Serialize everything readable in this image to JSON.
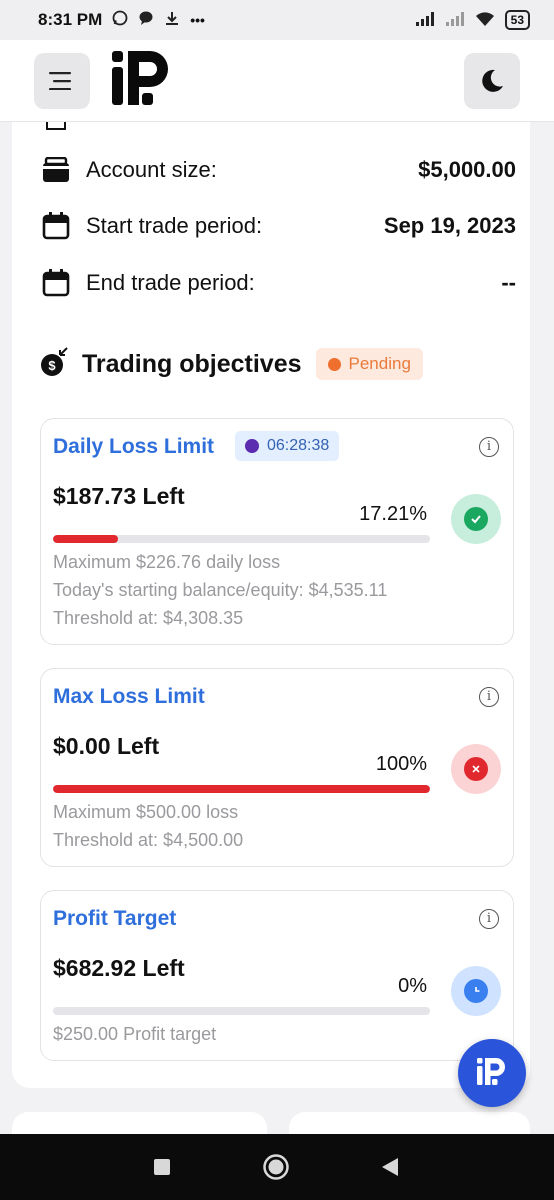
{
  "status_bar": {
    "time": "8:31 PM",
    "notif_icons": [
      "whatsapp-icon",
      "chat-icon",
      "download-icon"
    ],
    "more": "•••",
    "battery": "53"
  },
  "header": {
    "menu_icon": "hamburger-icon",
    "logo_icon": "brand-logo",
    "theme_icon": "moon-icon"
  },
  "account": {
    "rows": [
      {
        "label": "Account size:",
        "value": "$5,000.00",
        "icon": "wallet-icon"
      },
      {
        "label": "Start trade period:",
        "value": "Sep 19, 2023",
        "icon": "calendar-icon"
      },
      {
        "label": "End trade period:",
        "value": "--",
        "icon": "calendar-icon"
      }
    ]
  },
  "objectives": {
    "title": "Trading objectives",
    "status": "Pending",
    "cards": [
      {
        "title": "Daily Loss Limit",
        "timer": "06:28:38",
        "left": "$187.73 Left",
        "percent": "17.21%",
        "progress": 0.1721,
        "status": "passed",
        "status_bg": "#c7eedc",
        "status_color": "#1aa760",
        "details": [
          "Maximum $226.76 daily loss",
          "Today's starting balance/equity: $4,535.11",
          "Threshold at: $4,308.35"
        ]
      },
      {
        "title": "Max Loss Limit",
        "left": "$0.00 Left",
        "percent": "100%",
        "progress": 1.0,
        "status": "failed",
        "status_bg": "#fbd3d5",
        "status_color": "#e0282e",
        "details": [
          "Maximum $500.00 loss",
          "Threshold at: $4,500.00"
        ]
      },
      {
        "title": "Profit Target",
        "left": "$682.92 Left",
        "percent": "0%",
        "progress": 0.0,
        "status": "pending",
        "status_bg": "#cfe2ff",
        "status_color": "#3a7ff0",
        "details": [
          "$250.00 Profit target"
        ]
      }
    ]
  },
  "colors": {
    "accent_blue": "#2f6fdc",
    "bar_red": "#e0282e",
    "fab_blue": "#2a54d9"
  }
}
